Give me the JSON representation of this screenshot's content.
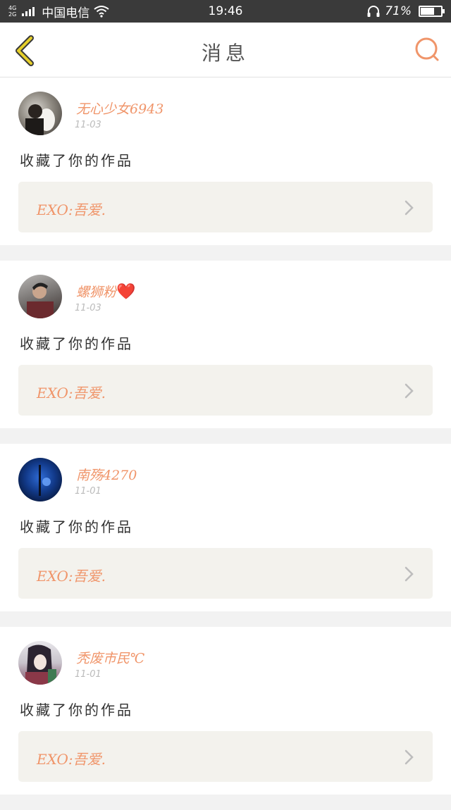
{
  "status_bar": {
    "network_top": "4G",
    "network_bottom": "2G",
    "carrier": "中国电信",
    "time": "19:46",
    "battery_percent": "71%",
    "battery_level": 0.71
  },
  "header": {
    "title": "消息",
    "back_icon": "chevron-left-icon",
    "search_icon": "search-icon"
  },
  "colors": {
    "accent": "#f0956a",
    "back_icon": "#e6cf2a"
  },
  "messages": [
    {
      "username": "无心少女6943",
      "emoji": "",
      "date": "11-03",
      "action": "收藏了你的作品",
      "work_title": "EXO:吾爱."
    },
    {
      "username": "螺狮粉",
      "emoji": "❤️",
      "date": "11-03",
      "action": "收藏了你的作品",
      "work_title": "EXO:吾爱."
    },
    {
      "username": "南殇4270",
      "emoji": "",
      "date": "11-01",
      "action": "收藏了你的作品",
      "work_title": "EXO:吾爱."
    },
    {
      "username": "秃废市民℃",
      "emoji": "",
      "date": "11-01",
      "action": "收藏了你的作品",
      "work_title": "EXO:吾爱."
    }
  ]
}
